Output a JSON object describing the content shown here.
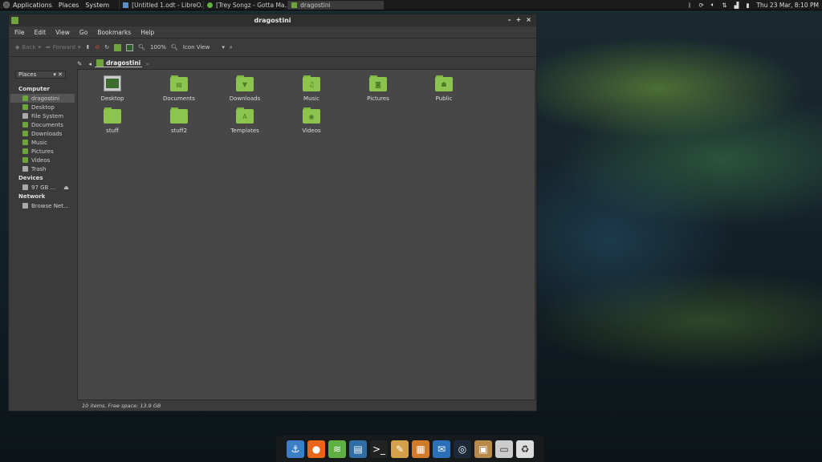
{
  "top_panel": {
    "menus": [
      "Applications",
      "Places",
      "System"
    ],
    "tasks": [
      {
        "label": "[Untitled 1.odt - LibreO...",
        "color": "#5b8fc7"
      },
      {
        "label": "[Trey Songz - Gotta Ma...",
        "color": "#5fb040"
      },
      {
        "label": "dragostini",
        "color": "#6fa33c",
        "active": true
      }
    ],
    "tray": {
      "clock": "Thu 23 Mar,  8:10 PM"
    }
  },
  "window": {
    "title": "dragostini",
    "controls": [
      "–",
      "+",
      "×"
    ],
    "menubar": [
      "File",
      "Edit",
      "View",
      "Go",
      "Bookmarks",
      "Help"
    ],
    "toolbar": {
      "back": "Back",
      "forward": "Forward",
      "zoom": "100%",
      "view_mode": "Icon View"
    },
    "path": {
      "current": "dragostini"
    },
    "sidebar": {
      "combo": "Places",
      "sections": [
        {
          "heading": "Computer",
          "items": [
            "dragostini",
            "Desktop",
            "File System",
            "Documents",
            "Downloads",
            "Music",
            "Pictures",
            "Videos",
            "Trash"
          ]
        },
        {
          "heading": "Devices",
          "items": [
            "97 GB ..."
          ]
        },
        {
          "heading": "Network",
          "items": [
            "Browse Net..."
          ]
        }
      ]
    },
    "files": [
      {
        "name": "Desktop",
        "glyph": ""
      },
      {
        "name": "Documents",
        "glyph": "▤"
      },
      {
        "name": "Downloads",
        "glyph": "▼"
      },
      {
        "name": "Music",
        "glyph": "♫"
      },
      {
        "name": "Pictures",
        "glyph": "◙"
      },
      {
        "name": "Public",
        "glyph": "☗"
      },
      {
        "name": "stuff",
        "glyph": ""
      },
      {
        "name": "stuff2",
        "glyph": ""
      },
      {
        "name": "Templates",
        "glyph": "A"
      },
      {
        "name": "Videos",
        "glyph": "◉"
      }
    ],
    "status": "10 items, Free space: 13.9 GB"
  },
  "dock": {
    "icons": [
      {
        "name": "anchor-icon",
        "glyph": "⚓",
        "color": "#3d7fc4"
      },
      {
        "name": "firefox-icon",
        "glyph": "●",
        "color": "#e8661a"
      },
      {
        "name": "spotify-icon",
        "glyph": "≋",
        "color": "#5fb040"
      },
      {
        "name": "writer-icon",
        "glyph": "▤",
        "color": "#2f6ea5"
      },
      {
        "name": "terminal-icon",
        "glyph": ">_",
        "color": "#222222"
      },
      {
        "name": "paint-icon",
        "glyph": "✎",
        "color": "#d4a04a"
      },
      {
        "name": "clapper-icon",
        "glyph": "▦",
        "color": "#d07a2a"
      },
      {
        "name": "thunderbird-icon",
        "glyph": "✉",
        "color": "#2a70b8"
      },
      {
        "name": "steam-icon",
        "glyph": "◎",
        "color": "#1b2838"
      },
      {
        "name": "archive-icon",
        "glyph": "▣",
        "color": "#b88a4a"
      },
      {
        "name": "drive-icon",
        "glyph": "▭",
        "color": "#cccccc"
      },
      {
        "name": "trash-icon",
        "glyph": "♻",
        "color": "#dddddd"
      }
    ]
  }
}
